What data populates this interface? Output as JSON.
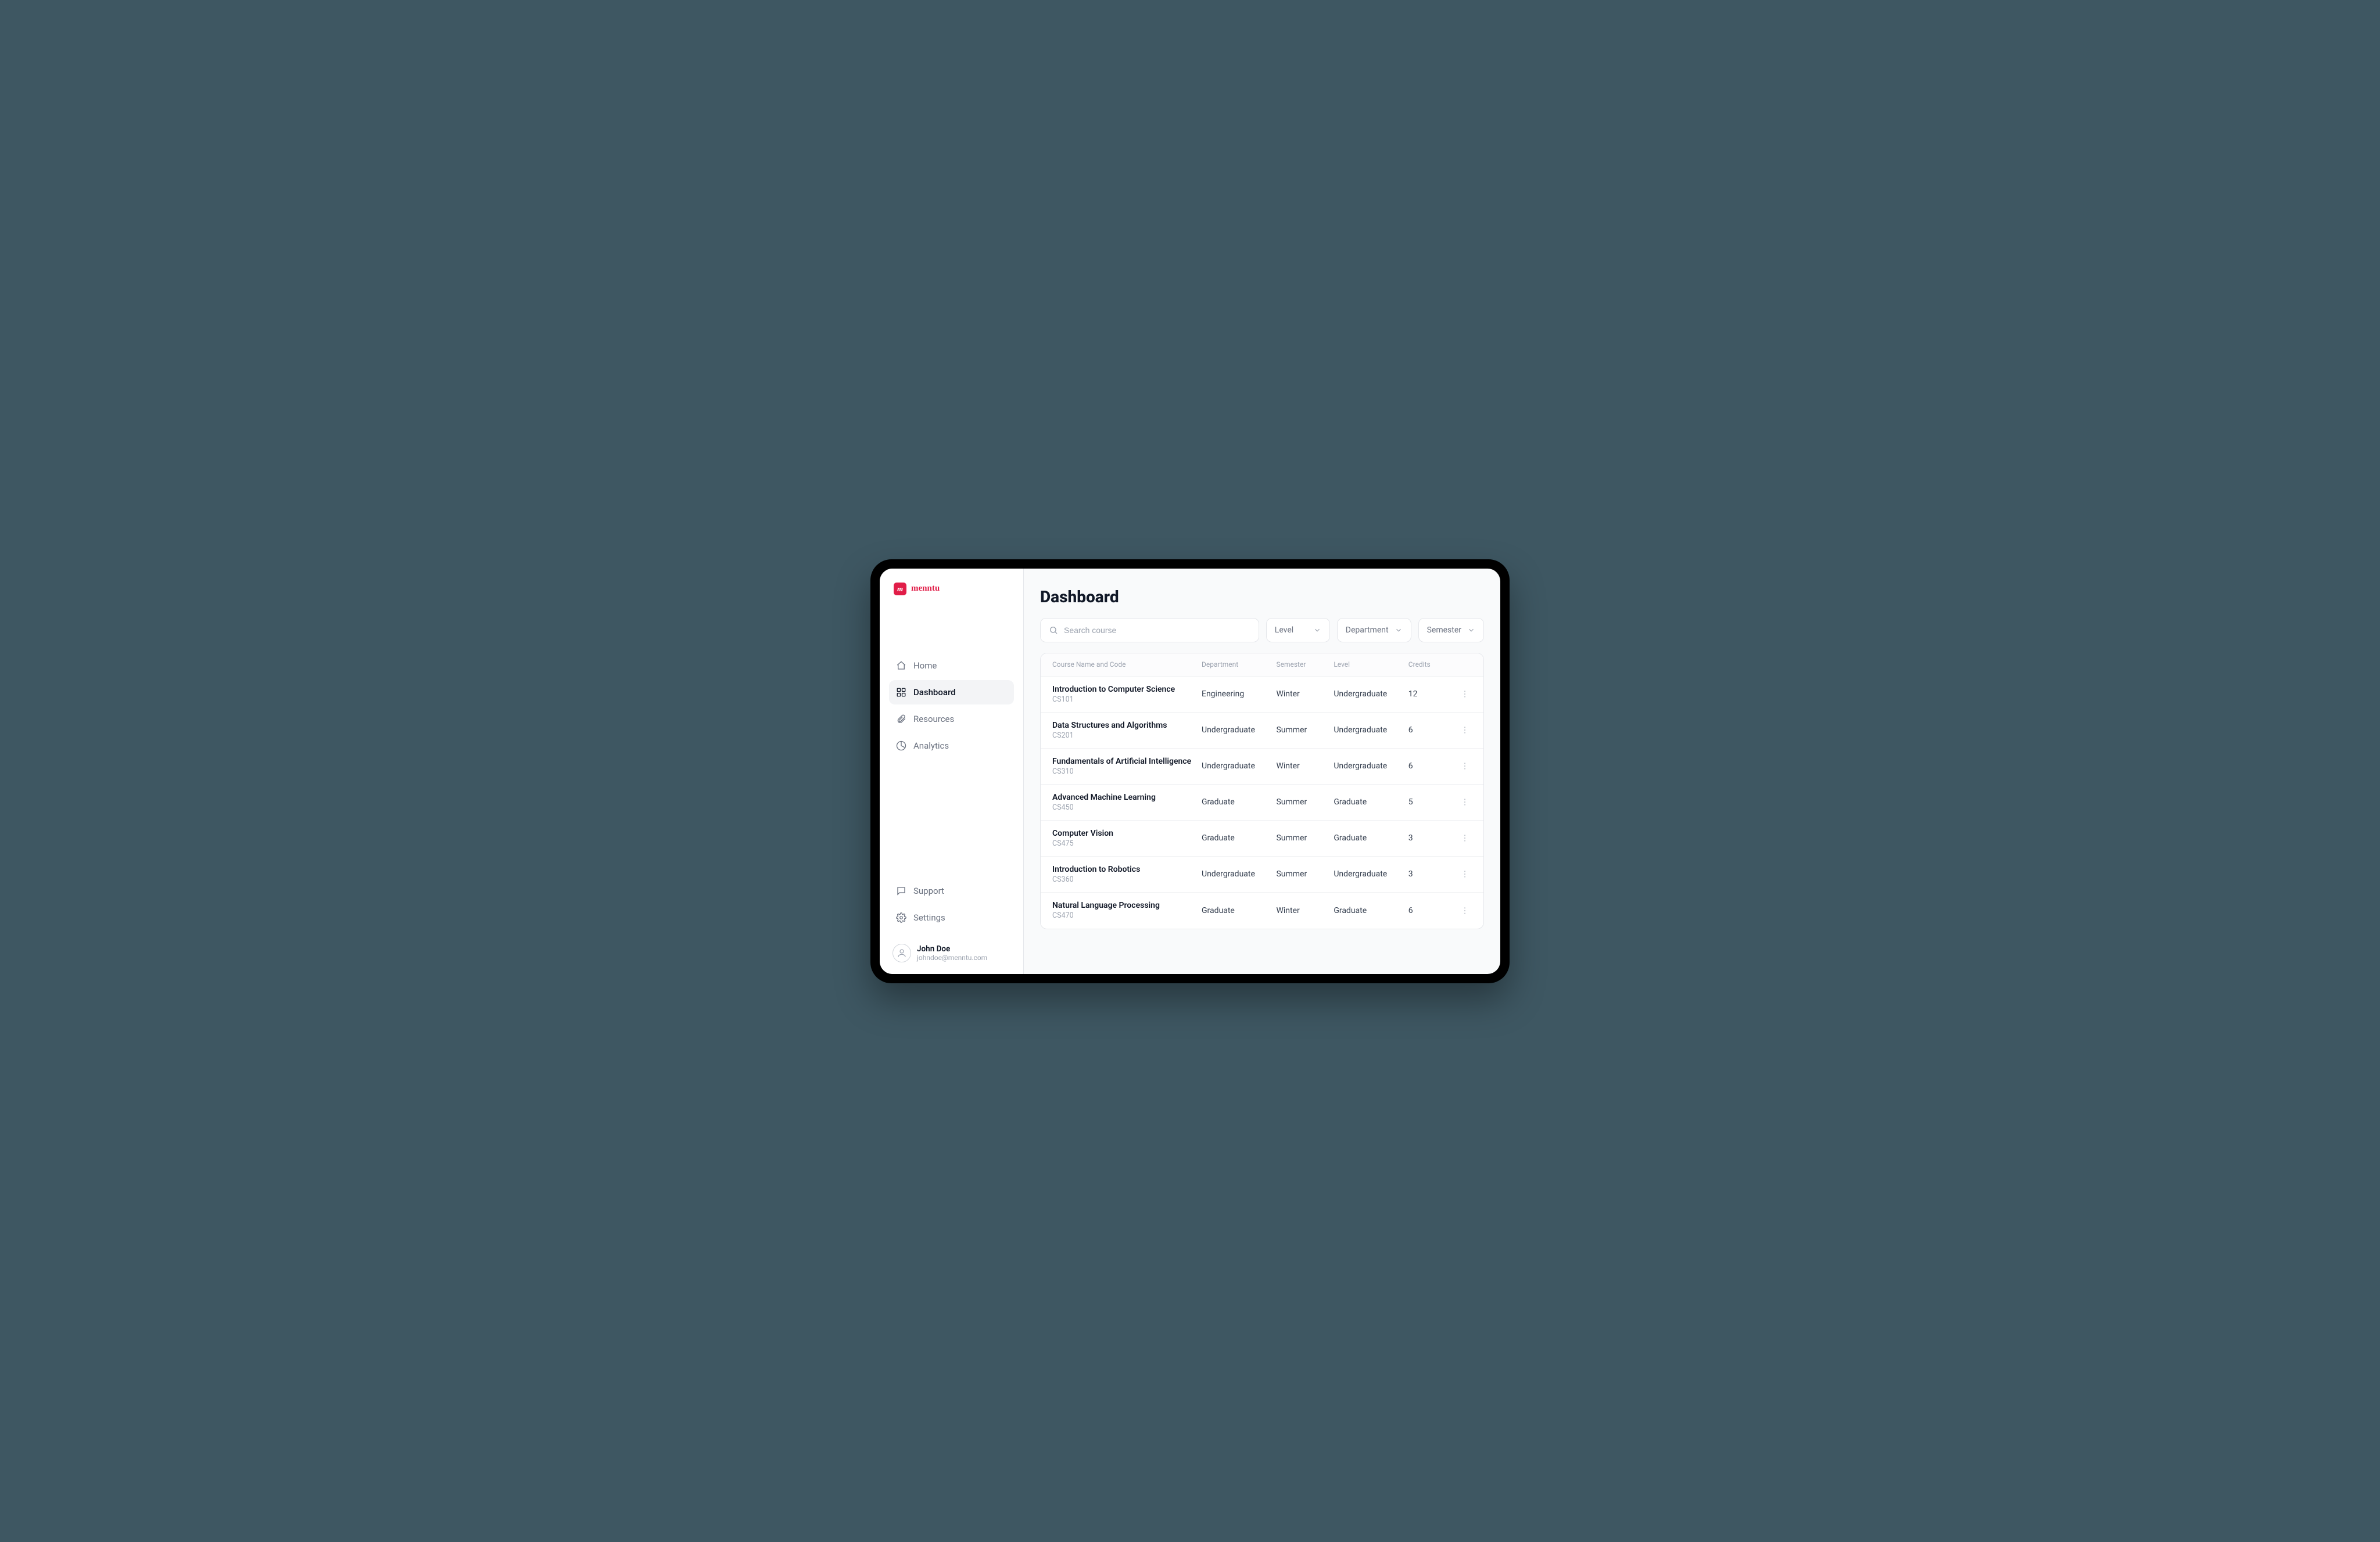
{
  "brand": {
    "badge": "m",
    "name": "menntu"
  },
  "sidebar": {
    "primary": [
      {
        "label": "Home",
        "icon": "home-icon",
        "active": false
      },
      {
        "label": "Dashboard",
        "icon": "dashboard-icon",
        "active": true
      },
      {
        "label": "Resources",
        "icon": "paperclip-icon",
        "active": false
      },
      {
        "label": "Analytics",
        "icon": "pie-icon",
        "active": false
      }
    ],
    "secondary": [
      {
        "label": "Support",
        "icon": "chat-icon"
      },
      {
        "label": "Settings",
        "icon": "gear-icon"
      }
    ]
  },
  "profile": {
    "name": "John Doe",
    "email": "johndoe@menntu.com"
  },
  "page": {
    "title": "Dashboard"
  },
  "filters": {
    "search_placeholder": "Search course",
    "selects": [
      {
        "label": "Level"
      },
      {
        "label": "Department"
      },
      {
        "label": "Semester"
      }
    ]
  },
  "table": {
    "columns": [
      "Course Name and Code",
      "Department",
      "Semester",
      "Level",
      "Credits"
    ],
    "rows": [
      {
        "name": "Introduction to Computer Science",
        "code": "CS101",
        "department": "Engineering",
        "semester": "Winter",
        "level": "Undergraduate",
        "credits": "12"
      },
      {
        "name": "Data Structures and Algorithms",
        "code": "CS201",
        "department": "Undergraduate",
        "semester": "Summer",
        "level": "Undergraduate",
        "credits": "6"
      },
      {
        "name": "Fundamentals of Artificial Intelligence",
        "code": "CS310",
        "department": "Undergraduate",
        "semester": "Winter",
        "level": "Undergraduate",
        "credits": "6"
      },
      {
        "name": "Advanced Machine Learning",
        "code": "CS450",
        "department": "Graduate",
        "semester": "Summer",
        "level": "Graduate",
        "credits": "5"
      },
      {
        "name": "Computer Vision",
        "code": "CS475",
        "department": "Graduate",
        "semester": "Summer",
        "level": "Graduate",
        "credits": "3"
      },
      {
        "name": "Introduction to Robotics",
        "code": "CS360",
        "department": "Undergraduate",
        "semester": "Summer",
        "level": "Undergraduate",
        "credits": "3"
      },
      {
        "name": "Natural Language Processing",
        "code": "CS470",
        "department": "Graduate",
        "semester": "Winter",
        "level": "Graduate",
        "credits": "6"
      }
    ]
  }
}
